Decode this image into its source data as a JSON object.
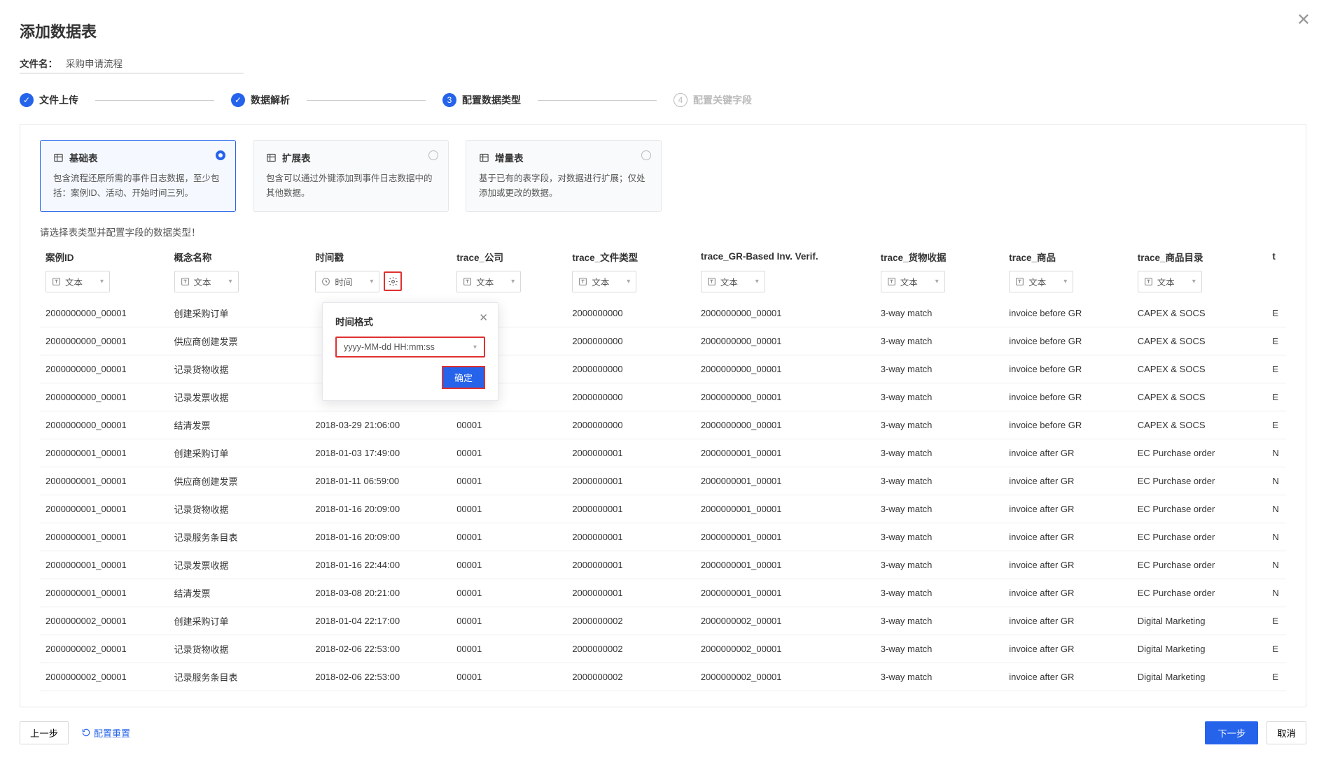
{
  "title": "添加数据表",
  "filename_label": "文件名：",
  "filename_value": "采购申请流程",
  "steps": [
    {
      "label": "文件上传",
      "state": "done"
    },
    {
      "label": "数据解析",
      "state": "done"
    },
    {
      "label": "配置数据类型",
      "state": "current",
      "num": "3"
    },
    {
      "label": "配置关键字段",
      "state": "next",
      "num": "4"
    }
  ],
  "type_cards": [
    {
      "title": "基础表",
      "desc": "包含流程还原所需的事件日志数据，至少包括：案例ID、活动、开始时间三列。",
      "selected": true
    },
    {
      "title": "扩展表",
      "desc": "包含可以通过外键添加到事件日志数据中的其他数据。",
      "selected": false
    },
    {
      "title": "增量表",
      "desc": "基于已有的表字段，对数据进行扩展；仅处添加或更改的数据。",
      "selected": false
    }
  ],
  "hint": "请选择表类型并配置字段的数据类型！",
  "columns": [
    {
      "key": "case_id",
      "label": "案例ID",
      "type_label": "文本",
      "type_icon": "text"
    },
    {
      "key": "concept_name",
      "label": "概念名称",
      "type_label": "文本",
      "type_icon": "text"
    },
    {
      "key": "timestamp",
      "label": "时间戳",
      "type_label": "时间",
      "type_icon": "time",
      "gear": true
    },
    {
      "key": "trace_company",
      "label": "trace_公司",
      "type_label": "文本",
      "type_icon": "text"
    },
    {
      "key": "trace_filetype",
      "label": "trace_文件类型",
      "type_label": "文本",
      "type_icon": "text"
    },
    {
      "key": "trace_gr",
      "label": "trace_GR-Based Inv. Verif.",
      "type_label": "文本",
      "type_icon": "text"
    },
    {
      "key": "trace_goods",
      "label": "trace_货物收据",
      "type_label": "文本",
      "type_icon": "text"
    },
    {
      "key": "trace_product",
      "label": "trace_商品",
      "type_label": "文本",
      "type_icon": "text"
    },
    {
      "key": "trace_catalog",
      "label": "trace_商品目录",
      "type_label": "文本",
      "type_icon": "text"
    }
  ],
  "extra_col_hint": "t",
  "rows": [
    {
      "case_id": "2000000000_00001",
      "concept_name": "创建采购订单",
      "timestamp": "",
      "trace_company": "",
      "trace_filetype": "2000000000",
      "trace_gr": "2000000000_00001",
      "trace_goods": "3-way match",
      "trace_product": "invoice before GR",
      "trace_catalog": "CAPEX & SOCS",
      "extra": "E"
    },
    {
      "case_id": "2000000000_00001",
      "concept_name": "供应商创建发票",
      "timestamp": "",
      "trace_company": "",
      "trace_filetype": "2000000000",
      "trace_gr": "2000000000_00001",
      "trace_goods": "3-way match",
      "trace_product": "invoice before GR",
      "trace_catalog": "CAPEX & SOCS",
      "extra": "E"
    },
    {
      "case_id": "2000000000_00001",
      "concept_name": "记录货物收据",
      "timestamp": "",
      "trace_company": "",
      "trace_filetype": "2000000000",
      "trace_gr": "2000000000_00001",
      "trace_goods": "3-way match",
      "trace_product": "invoice before GR",
      "trace_catalog": "CAPEX & SOCS",
      "extra": "E"
    },
    {
      "case_id": "2000000000_00001",
      "concept_name": "记录发票收据",
      "timestamp": "",
      "trace_company": "",
      "trace_filetype": "2000000000",
      "trace_gr": "2000000000_00001",
      "trace_goods": "3-way match",
      "trace_product": "invoice before GR",
      "trace_catalog": "CAPEX & SOCS",
      "extra": "E"
    },
    {
      "case_id": "2000000000_00001",
      "concept_name": "结清发票",
      "timestamp": "2018-03-29 21:06:00",
      "trace_company": "00001",
      "trace_filetype": "2000000000",
      "trace_gr": "2000000000_00001",
      "trace_goods": "3-way match",
      "trace_product": "invoice before GR",
      "trace_catalog": "CAPEX & SOCS",
      "extra": "E"
    },
    {
      "case_id": "2000000001_00001",
      "concept_name": "创建采购订单",
      "timestamp": "2018-01-03 17:49:00",
      "trace_company": "00001",
      "trace_filetype": "2000000001",
      "trace_gr": "2000000001_00001",
      "trace_goods": "3-way match",
      "trace_product": "invoice after GR",
      "trace_catalog": "EC Purchase order",
      "extra": "N"
    },
    {
      "case_id": "2000000001_00001",
      "concept_name": "供应商创建发票",
      "timestamp": "2018-01-11 06:59:00",
      "trace_company": "00001",
      "trace_filetype": "2000000001",
      "trace_gr": "2000000001_00001",
      "trace_goods": "3-way match",
      "trace_product": "invoice after GR",
      "trace_catalog": "EC Purchase order",
      "extra": "N"
    },
    {
      "case_id": "2000000001_00001",
      "concept_name": "记录货物收据",
      "timestamp": "2018-01-16 20:09:00",
      "trace_company": "00001",
      "trace_filetype": "2000000001",
      "trace_gr": "2000000001_00001",
      "trace_goods": "3-way match",
      "trace_product": "invoice after GR",
      "trace_catalog": "EC Purchase order",
      "extra": "N"
    },
    {
      "case_id": "2000000001_00001",
      "concept_name": "记录服务条目表",
      "timestamp": "2018-01-16 20:09:00",
      "trace_company": "00001",
      "trace_filetype": "2000000001",
      "trace_gr": "2000000001_00001",
      "trace_goods": "3-way match",
      "trace_product": "invoice after GR",
      "trace_catalog": "EC Purchase order",
      "extra": "N"
    },
    {
      "case_id": "2000000001_00001",
      "concept_name": "记录发票收据",
      "timestamp": "2018-01-16 22:44:00",
      "trace_company": "00001",
      "trace_filetype": "2000000001",
      "trace_gr": "2000000001_00001",
      "trace_goods": "3-way match",
      "trace_product": "invoice after GR",
      "trace_catalog": "EC Purchase order",
      "extra": "N"
    },
    {
      "case_id": "2000000001_00001",
      "concept_name": "结清发票",
      "timestamp": "2018-03-08 20:21:00",
      "trace_company": "00001",
      "trace_filetype": "2000000001",
      "trace_gr": "2000000001_00001",
      "trace_goods": "3-way match",
      "trace_product": "invoice after GR",
      "trace_catalog": "EC Purchase order",
      "extra": "N"
    },
    {
      "case_id": "2000000002_00001",
      "concept_name": "创建采购订单",
      "timestamp": "2018-01-04 22:17:00",
      "trace_company": "00001",
      "trace_filetype": "2000000002",
      "trace_gr": "2000000002_00001",
      "trace_goods": "3-way match",
      "trace_product": "invoice after GR",
      "trace_catalog": "Digital Marketing",
      "extra": "E"
    },
    {
      "case_id": "2000000002_00001",
      "concept_name": "记录货物收据",
      "timestamp": "2018-02-06 22:53:00",
      "trace_company": "00001",
      "trace_filetype": "2000000002",
      "trace_gr": "2000000002_00001",
      "trace_goods": "3-way match",
      "trace_product": "invoice after GR",
      "trace_catalog": "Digital Marketing",
      "extra": "E"
    },
    {
      "case_id": "2000000002_00001",
      "concept_name": "记录服务条目表",
      "timestamp": "2018-02-06 22:53:00",
      "trace_company": "00001",
      "trace_filetype": "2000000002",
      "trace_gr": "2000000002_00001",
      "trace_goods": "3-way match",
      "trace_product": "invoice after GR",
      "trace_catalog": "Digital Marketing",
      "extra": "E"
    }
  ],
  "popover": {
    "title": "时间格式",
    "value": "yyyy-MM-dd HH:mm:ss",
    "confirm": "确定"
  },
  "footer": {
    "prev": "上一步",
    "reset": "配置重置",
    "next": "下一步",
    "cancel": "取消"
  }
}
